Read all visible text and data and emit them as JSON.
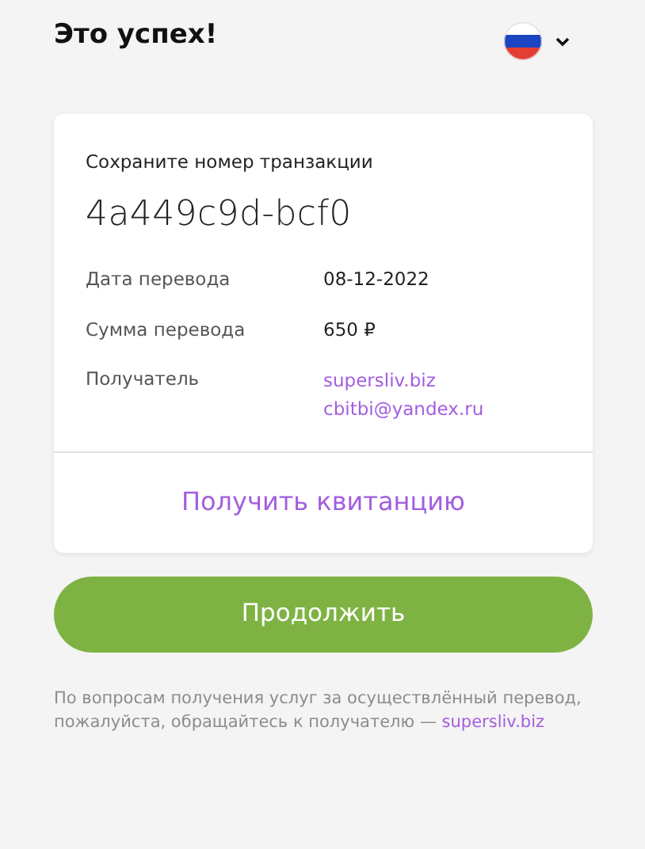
{
  "header": {
    "title": "Это успех!"
  },
  "card": {
    "caption": "Сохраните номер транзакции",
    "transaction_id": "4a449c9d-bcf0",
    "details": [
      {
        "label": "Дата перевода",
        "kind": "text",
        "values": [
          "08-12-2022"
        ]
      },
      {
        "label": "Сумма перевода",
        "kind": "text",
        "values": [
          "650 ₽"
        ]
      },
      {
        "label": "Получатель",
        "kind": "link",
        "values": [
          "supersliv.biz",
          "cbitbi@yandex.ru"
        ]
      }
    ],
    "receipt_link": "Получить квитанцию"
  },
  "continue_button": "Продолжить",
  "footer": {
    "text": "По вопросам получения услуг за осуществлённый перевод, пожалуйста, обращайтесь к получателю —",
    "link": "supersliv.biz"
  }
}
